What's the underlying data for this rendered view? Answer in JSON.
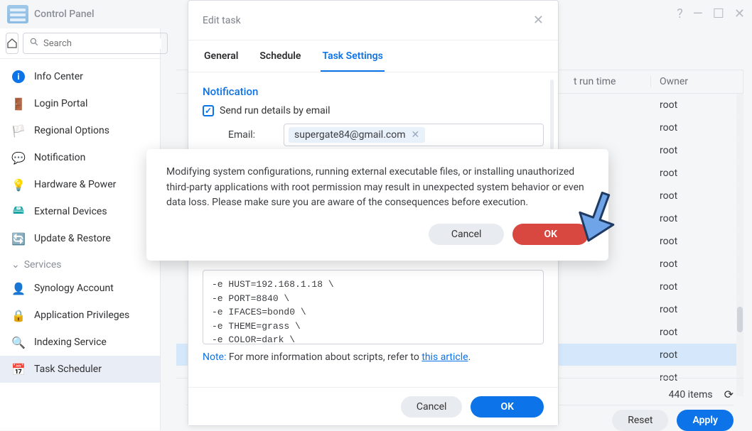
{
  "titlebar": {
    "appname": "Control Panel"
  },
  "search": {
    "placeholder": "Search"
  },
  "sidebar": {
    "items": [
      {
        "label": "Info Center"
      },
      {
        "label": "Login Portal"
      },
      {
        "label": "Regional Options"
      },
      {
        "label": "Notification"
      },
      {
        "label": "Hardware & Power"
      },
      {
        "label": "External Devices"
      },
      {
        "label": "Update & Restore"
      }
    ],
    "servicesLabel": "Services",
    "services": [
      {
        "label": "Synology Account"
      },
      {
        "label": "Application Privileges"
      },
      {
        "label": "Indexing Service"
      },
      {
        "label": "Task Scheduler"
      }
    ]
  },
  "table": {
    "headers": {
      "runtime": "t run time",
      "owner": "Owner"
    },
    "rows": [
      {
        "owner": "root"
      },
      {
        "owner": "root"
      },
      {
        "owner": "root"
      },
      {
        "owner": "root"
      },
      {
        "owner": "root"
      },
      {
        "owner": "root"
      },
      {
        "owner": "root"
      },
      {
        "owner": "root"
      },
      {
        "owner": "root"
      },
      {
        "owner": "root"
      },
      {
        "owner": "root"
      },
      {
        "owner": "root"
      },
      {
        "owner": "root"
      }
    ],
    "selectedIndex": 11,
    "footer": {
      "count": "440 items",
      "reset": "Reset",
      "apply": "Apply"
    }
  },
  "modalEdit": {
    "title": "Edit task",
    "tabs": [
      "General",
      "Schedule",
      "Task Settings"
    ],
    "activeTab": 2,
    "sections": {
      "notification": {
        "title": "Notification",
        "checkbox_label": "Send run details by email",
        "email_label": "Email:",
        "email_value": "supergate84@gmail.com"
      },
      "script": {
        "code": "-e HUST=192.168.1.18 \\\n-e PORT=8840 \\\n-e IFACES=bond0 \\\n-e THEME=grass \\\n-e COLOR=dark \\",
        "note_label": "Note:",
        "note_text": " For more information about scripts, refer to ",
        "note_link": "this article",
        "note_period": "."
      }
    },
    "footer": {
      "cancel": "Cancel",
      "ok": "OK"
    }
  },
  "modalConfirm": {
    "text": "Modifying system configurations, running external executable files, or installing unauthorized third-party applications with root permission may result in unexpected system behavior or even data loss. Please make sure you are aware of the consequences before execution.",
    "cancel": "Cancel",
    "ok": "OK"
  }
}
